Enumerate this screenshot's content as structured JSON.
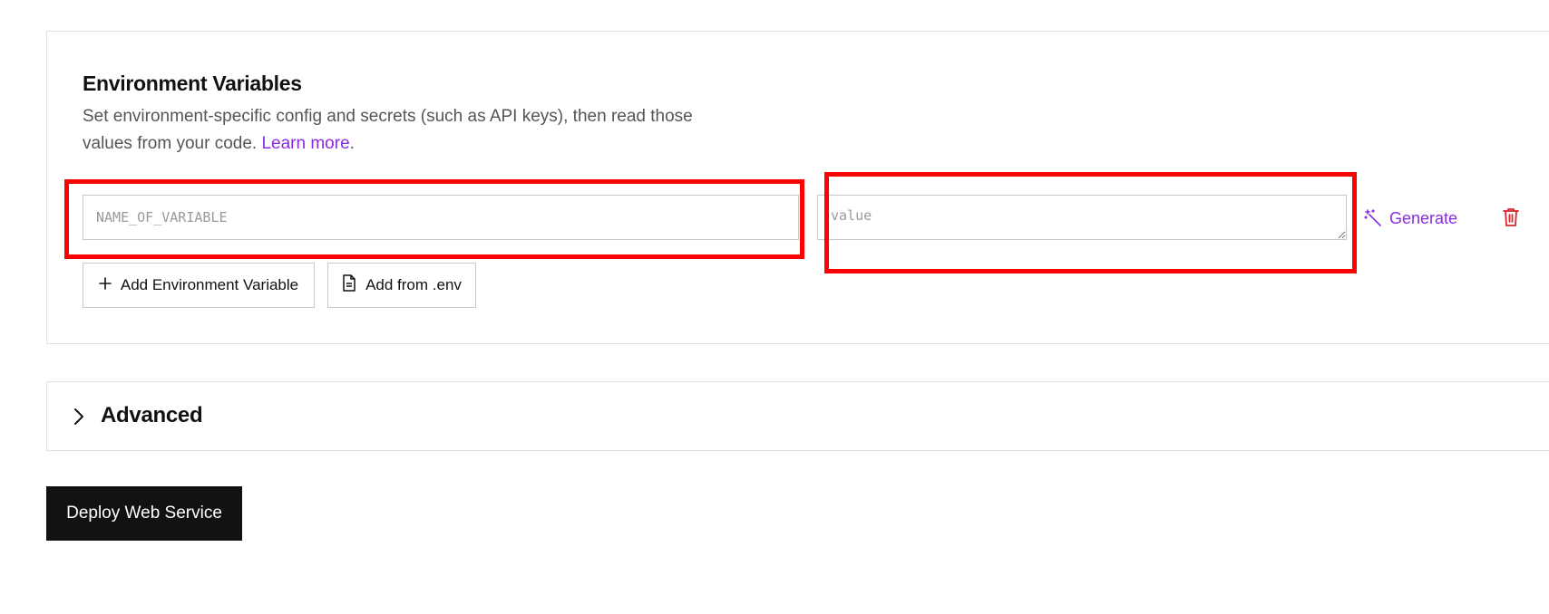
{
  "env_section": {
    "title": "Environment Variables",
    "description": "Set environment-specific config and secrets (such as API keys), then read those values from your code.",
    "learn_more": "Learn more",
    "trailing_period": ".",
    "key_placeholder": "NAME_OF_VARIABLE",
    "key_value": "",
    "value_placeholder": "value",
    "value_value": "",
    "generate_label": "Generate",
    "add_variable_label": "Add Environment Variable",
    "add_from_env_label": "Add from .env"
  },
  "advanced": {
    "title": "Advanced"
  },
  "deploy": {
    "label": "Deploy Web Service"
  },
  "colors": {
    "accent": "#8a2be2",
    "danger": "#d9262c",
    "highlight": "#ff0000",
    "primary_button": "#111111"
  },
  "icons": {
    "generate": "magic-wand-icon",
    "delete": "trash-icon",
    "add": "plus-icon",
    "file": "file-icon",
    "expand": "chevron-right-icon"
  }
}
